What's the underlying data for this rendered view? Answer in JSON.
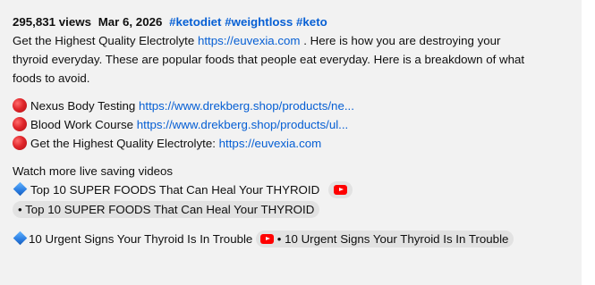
{
  "meta": {
    "views": "295,831 views",
    "date": "Mar 6, 2026",
    "hashtags": [
      "#ketodiet",
      "#weightloss",
      "#keto"
    ]
  },
  "description": {
    "intro_text": "Get the Highest Quality Electrolyte",
    "intro_link": "https://euvexia.com",
    "intro_rest_1": " . Here is how you are destroying your",
    "line2": "thyroid everyday. These are popular foods that people eat everyday. Here is a breakdown of what",
    "line3": "foods to avoid."
  },
  "links": [
    {
      "label": "Nexus Body Testing",
      "url": "https://www.drekberg.shop/products/ne...",
      "icon": "red-circle-icon"
    },
    {
      "label": "Blood Work Course",
      "url": "https://www.drekberg.shop/products/ul...",
      "icon": "red-circle-icon"
    },
    {
      "label": "Get the Highest Quality Electrolyte:",
      "url": "https://euvexia.com",
      "icon": "red-circle-icon"
    }
  ],
  "videos": {
    "heading": "Watch more live saving videos",
    "video1_title": "Top 10 SUPER FOODS That Can Heal Your THYROID",
    "video1_chip": "• Top 10 SUPER FOODS That Can Heal Your THYROID",
    "video2_title": "10 Urgent Signs Your Thyroid Is In Trouble",
    "video2_chip": "• 10 Urgent Signs Your Thyroid Is In Trouble"
  },
  "colors": {
    "link": "#065fd4",
    "background": "#f2f2f2",
    "youtube_red": "#ff0000"
  }
}
